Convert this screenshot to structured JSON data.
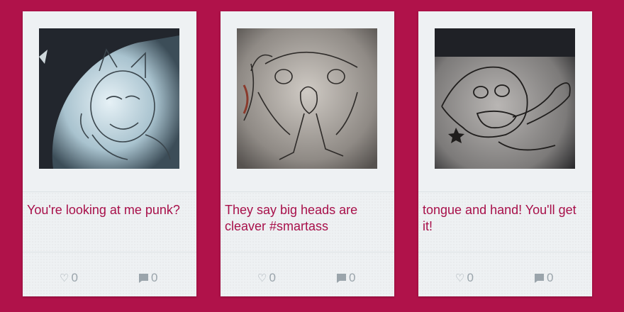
{
  "cards": [
    {
      "caption": "You're looking at me punk?",
      "likes": "0",
      "comments": "0",
      "image": "sketch-cat-face-on-leg"
    },
    {
      "caption": "They say big heads are cleaver #smartass",
      "likes": "0",
      "comments": "0",
      "image": "sketch-big-head-creature"
    },
    {
      "caption": "tongue and hand! You'll get it!",
      "likes": "0",
      "comments": "0",
      "image": "sketch-tongue-face"
    }
  ],
  "icons": {
    "like": "heart-outline-icon",
    "comment": "speech-bubble-icon"
  },
  "colors": {
    "background": "#b0124a",
    "card": "#eef1f3",
    "caption": "#a8104a",
    "meta": "#9aa4ab"
  }
}
